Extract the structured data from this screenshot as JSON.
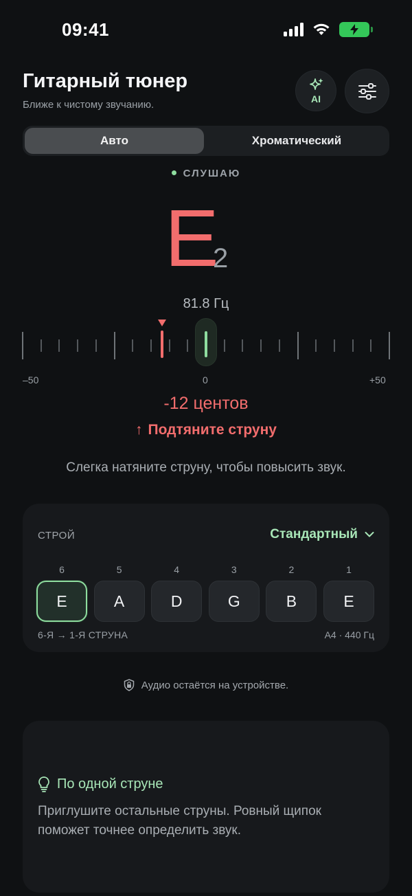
{
  "status": {
    "time": "09:41"
  },
  "header": {
    "title": "Гитарный тюнер",
    "subtitle": "Ближе к чистому звучанию.",
    "ai_label": "AI"
  },
  "mode": {
    "options": [
      "Авто",
      "Хроматический"
    ],
    "selected": "Авто"
  },
  "listening": "СЛУШАЮ",
  "reading": {
    "note": "E",
    "octave": "2",
    "frequency": "81.8 Гц",
    "cents_text": "-12 центов",
    "cents_value": -12,
    "action": "Подтяните струну",
    "hint": "Слегка натяните струну, чтобы повысить звук."
  },
  "meter": {
    "min_label": "–50",
    "mid_label": "0",
    "max_label": "+50"
  },
  "tuning": {
    "label": "СТРОЙ",
    "selected": "Стандартный",
    "strings": [
      {
        "num": "6",
        "note": "E",
        "active": true
      },
      {
        "num": "5",
        "note": "A",
        "active": false
      },
      {
        "num": "4",
        "note": "D",
        "active": false
      },
      {
        "num": "3",
        "note": "G",
        "active": false
      },
      {
        "num": "2",
        "note": "B",
        "active": false
      },
      {
        "num": "1",
        "note": "E",
        "active": false
      }
    ],
    "footer_left": "6-Я → 1-Я СТРУНА",
    "footer_right": "A4 · 440 Гц"
  },
  "privacy": "Аудио остаётся на устройстве.",
  "tip": {
    "title": "По одной струне",
    "text": "Приглушите остальные струны. Ровный щипок поможет точнее определить звук."
  },
  "colors": {
    "accent_green": "#8fdd9f",
    "alert_red": "#f26d6d",
    "background": "#0f1113"
  }
}
